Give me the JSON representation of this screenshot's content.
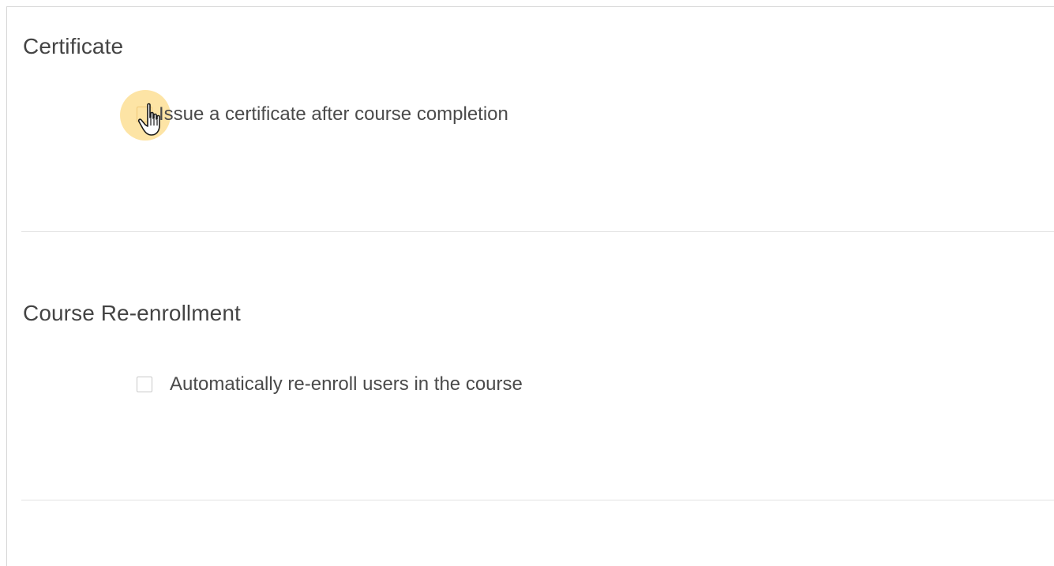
{
  "certificate": {
    "title": "Certificate",
    "option_label": "Issue a certificate after course completion",
    "checked": false
  },
  "reenrollment": {
    "title": "Course Re-enrollment",
    "option_label": "Automatically re-enroll users in the course",
    "checked": false
  },
  "icons": {
    "cursor": "hand-pointer-icon"
  },
  "colors": {
    "focus_halo": "#fbd36e",
    "text": "#444444",
    "divider": "#e3e3e3",
    "checkbox_border": "#c9c9c9"
  }
}
